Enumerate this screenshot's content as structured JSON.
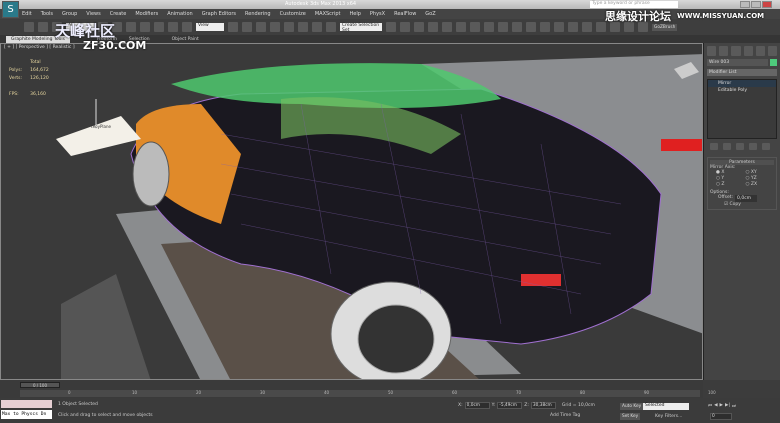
{
  "app": {
    "logo": "S",
    "title": "Autodesk 3ds Max 2013 x64",
    "search_placeholder": "Type a keyword or phrase"
  },
  "menu": [
    "Edit",
    "Tools",
    "Group",
    "Views",
    "Create",
    "Modifiers",
    "Animation",
    "Graph Editors",
    "Rendering",
    "Customize",
    "MAXScript",
    "Help",
    "PhysX",
    "RealFlow",
    "GoZ"
  ],
  "toolbar": {
    "filter": "All",
    "ref_coord": "View",
    "selection_set": "Create Selection Set",
    "goz": "GoZBrush"
  },
  "ribbon": {
    "tabs": [
      "Graphite Modeling Tools",
      "Freeform",
      "Selection",
      "Object Paint"
    ]
  },
  "viewport": {
    "label": "[ + ] [ Perspective ] [ Realistic ]",
    "stats": {
      "header": "Total",
      "polys_label": "Polys:",
      "polys": "164,672",
      "verts_label": "Verts:",
      "verts": "126,120",
      "fps_label": "FPS:",
      "fps": "36,160"
    },
    "gizmo_label": "tRoyPlane"
  },
  "watermarks": {
    "left_cn": "天峰社区",
    "left_en": "ZF30.COM",
    "right_cn": "思缘设计论坛",
    "right_en": "WWW.MISSYUAN.COM"
  },
  "command_panel": {
    "object_name": "Wire 003",
    "object_color": "#4ecb7c",
    "modifier_list": "Modifier List",
    "stack": [
      "Mirror",
      "Editable Poly"
    ],
    "rollout": "Parameters",
    "mirror_axis_label": "Mirror Axis:",
    "axes": [
      "X",
      "Y",
      "Z",
      "XY",
      "YZ",
      "ZX"
    ],
    "selected_axis": "X",
    "options_label": "Options:",
    "offset_label": "Offset:",
    "offset": "0,0cm",
    "copy_label": "Copy",
    "copy_checked": true
  },
  "timeline": {
    "slider": "0 / 100",
    "ticks": [
      "0",
      "10",
      "20",
      "30",
      "40",
      "50",
      "60",
      "70",
      "80",
      "90",
      "100"
    ]
  },
  "status": {
    "maxscript_input": "Max to Physcs Dn",
    "selected": "1 Object Selected",
    "prompt": "Click and drag to select and move objects",
    "x_label": "X:",
    "x": "0,0cm",
    "y_label": "Y:",
    "y": "-5,49cm",
    "z_label": "Z:",
    "z": "30,38cm",
    "grid": "Grid = 10,0cm",
    "add_time_tag": "Add Time Tag",
    "auto_key": "Auto Key",
    "key_mode": "Selected",
    "set_key": "Set Key",
    "key_filters": "Key Filters...",
    "frame": "0"
  }
}
